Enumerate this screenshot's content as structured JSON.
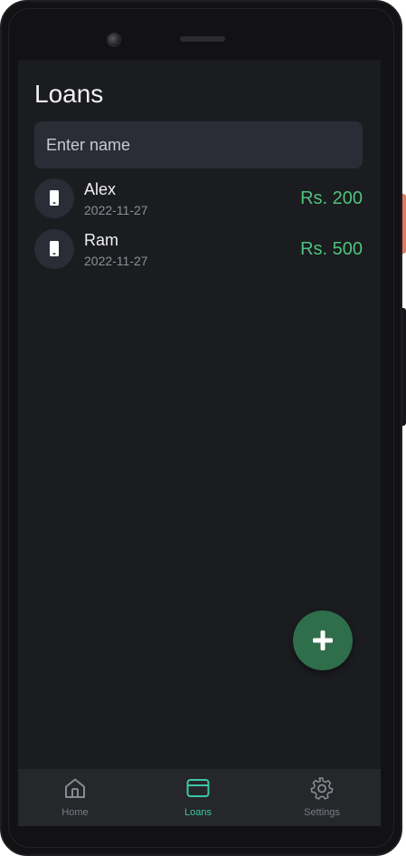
{
  "screen": {
    "title": "Loans"
  },
  "search": {
    "placeholder": "Enter name",
    "value": ""
  },
  "loans": [
    {
      "name": "Alex",
      "date": "2022-11-27",
      "amount": "Rs. 200",
      "icon": "phone-icon"
    },
    {
      "name": "Ram",
      "date": "2022-11-27",
      "amount": "Rs. 500",
      "icon": "phone-icon"
    }
  ],
  "fab": {
    "icon": "plus-icon"
  },
  "bottom_nav": {
    "items": [
      {
        "label": "Home",
        "icon": "home-icon",
        "active": false
      },
      {
        "label": "Loans",
        "icon": "card-icon",
        "active": true
      },
      {
        "label": "Settings",
        "icon": "gear-icon",
        "active": false
      }
    ]
  },
  "colors": {
    "background": "#1b1c20",
    "amount": "#4ec27d",
    "accent": "#3cc7a5",
    "fab": "#2f6e4a"
  }
}
